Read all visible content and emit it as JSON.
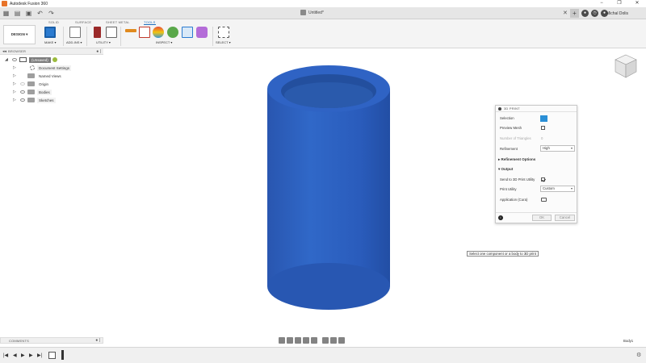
{
  "app": {
    "title": "Autodesk Fusion 360"
  },
  "window_controls": {
    "minimize": "−",
    "maximize": "❐",
    "close": "✕"
  },
  "doc": {
    "tab_label": "Untitled*",
    "close": "✕",
    "user": "Michal Dolis"
  },
  "ribbon": {
    "tabs": [
      "SOLID",
      "SURFACE",
      "SHEET METAL",
      "TOOLS"
    ],
    "active_tab": "TOOLS",
    "workspace": "DESIGN ▾",
    "groups": [
      "MAKE ▾",
      "ADD-INS ▾",
      "UTILITY ▾",
      "INSPECT ▾",
      "SELECT ▾"
    ]
  },
  "browser": {
    "title": "BROWSER",
    "root": "(Unsaved)",
    "items": [
      {
        "label": "Document Settings",
        "icon": "gear-icon"
      },
      {
        "label": "Named Views",
        "icon": "folder-icon"
      },
      {
        "label": "Origin",
        "icon": "folder-icon"
      },
      {
        "label": "Bodies",
        "icon": "folder-icon"
      },
      {
        "label": "Sketches",
        "icon": "folder-icon"
      }
    ]
  },
  "dialog": {
    "title": "3D PRINT",
    "selection_label": "Selection",
    "preview_mesh_label": "Preview Mesh",
    "triangles_label": "Number of Triangles",
    "triangles_value": "0",
    "refinement_label": "Refinement",
    "refinement_value": "High",
    "refinement_options": "Refinement Options",
    "output_section": "Output",
    "send_label": "Send to 3D Print Utility",
    "print_utility_label": "Print Utility",
    "print_utility_value": "Custom",
    "application_label": "Application (Cura)",
    "ok": "OK",
    "cancel": "Cancel",
    "info": "i"
  },
  "tooltip": {
    "text": "Select one component or a body to 3D print"
  },
  "comments": {
    "title": "COMMENTS"
  },
  "status": {
    "body_label": "Body1"
  },
  "colors": {
    "body_blue": "#2f63c0",
    "accent": "#1f6fbf",
    "selection_blue": "#2a8fd6"
  }
}
